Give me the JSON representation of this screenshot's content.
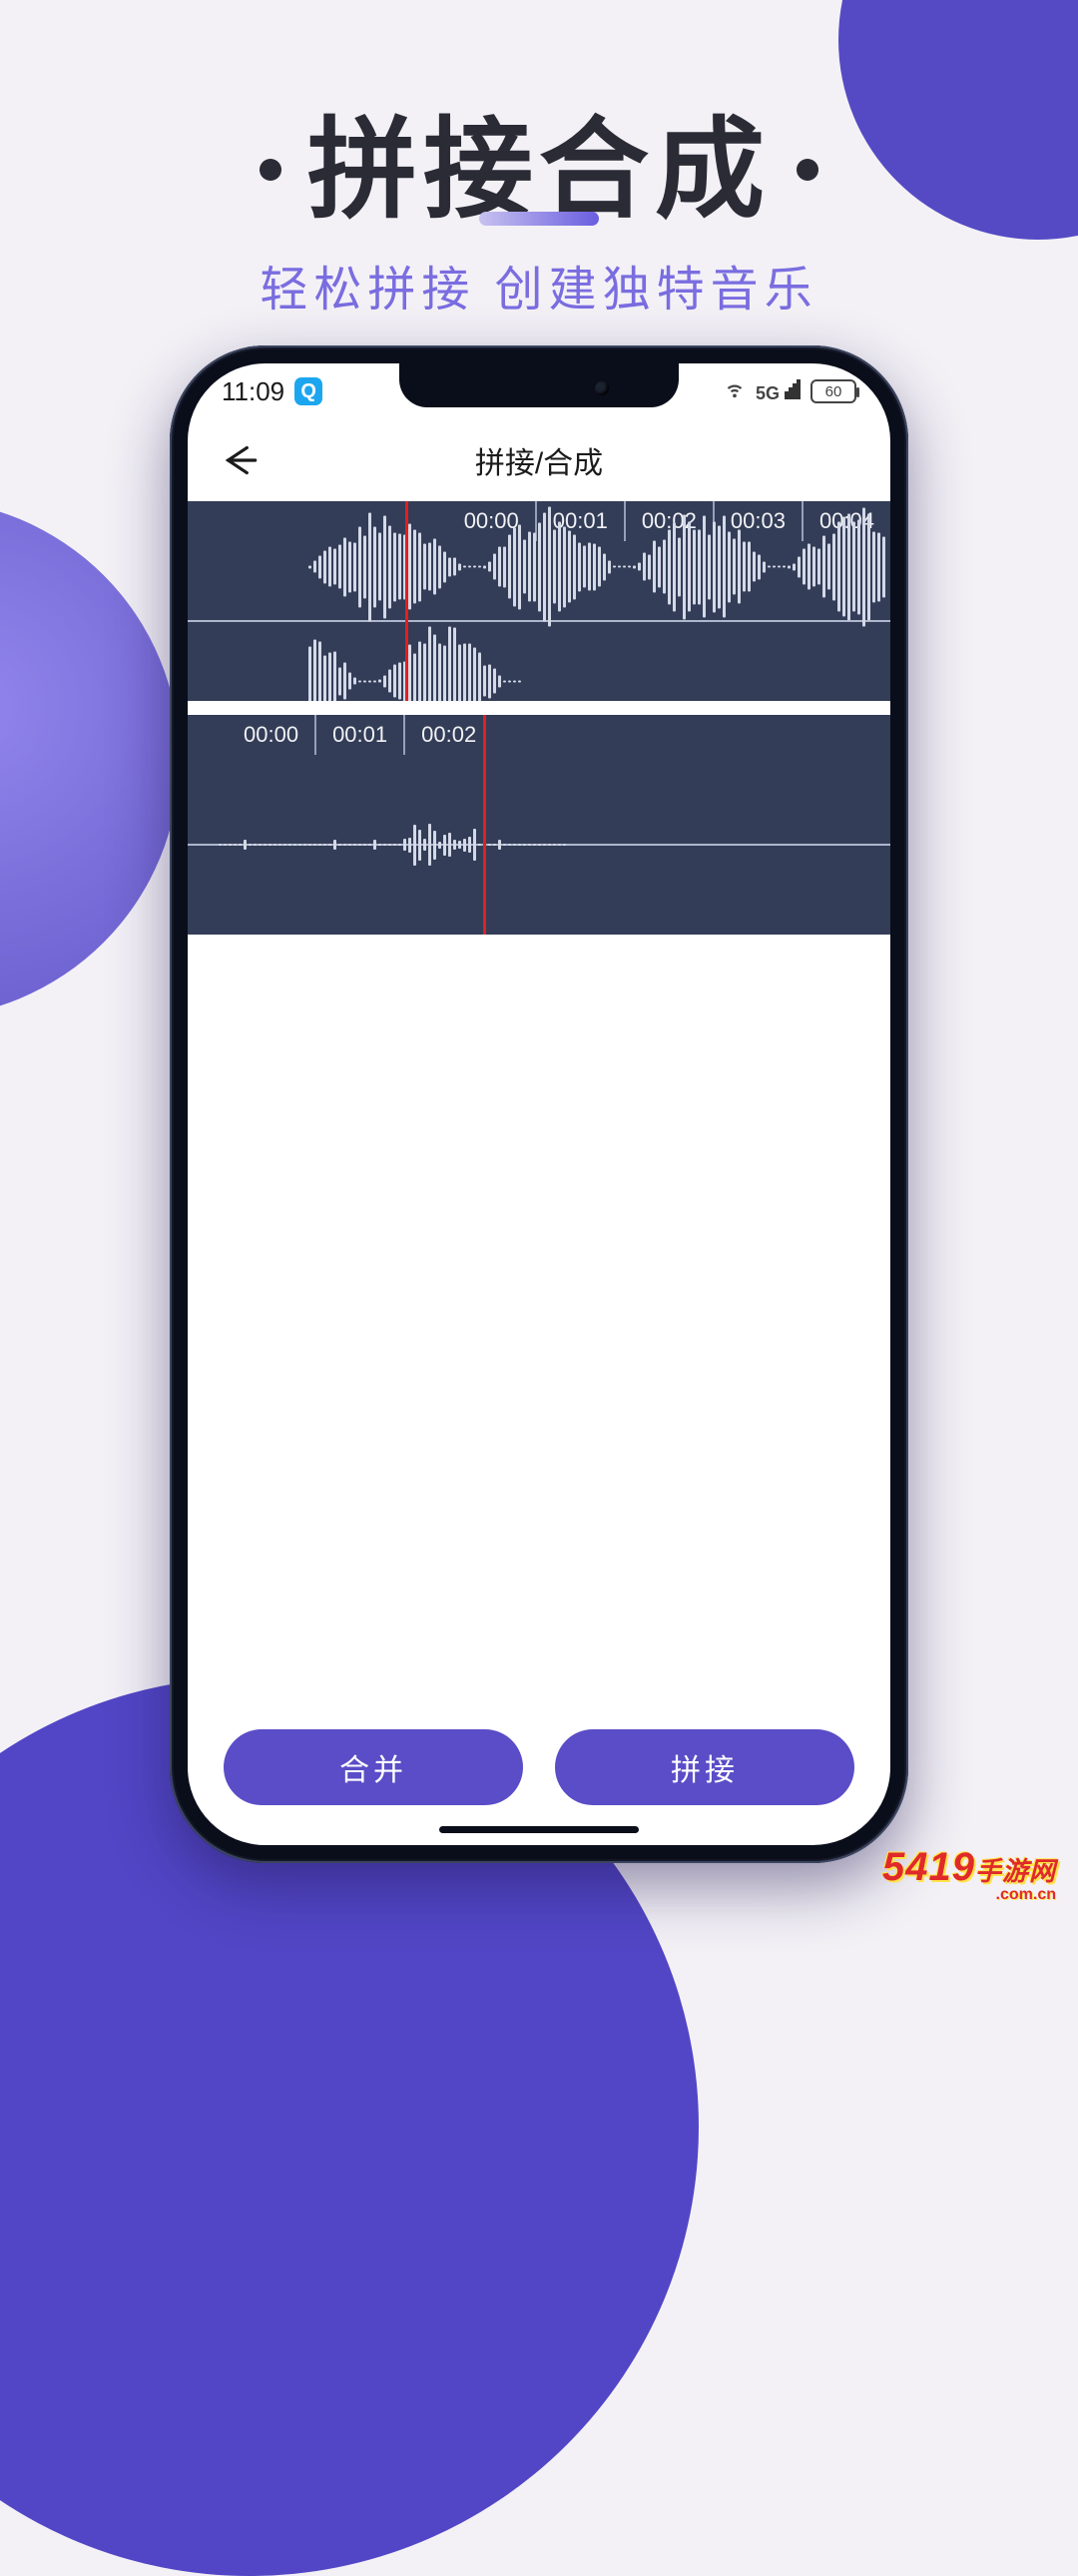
{
  "promo": {
    "title": "拼接合成",
    "subtitle": "轻松拼接 创建独特音乐"
  },
  "status": {
    "time": "11:09",
    "app_badge": "Q",
    "network_label": "5G",
    "battery_text": "60"
  },
  "nav": {
    "title": "拼接/合成"
  },
  "track1": {
    "ticks": [
      "00:00",
      "00:01",
      "00:02",
      "00:03",
      "00:04"
    ],
    "playhead_pct": 31
  },
  "track2": {
    "ticks": [
      "00:00",
      "00:01",
      "00:02"
    ],
    "playhead_pct": 42
  },
  "buttons": {
    "merge": "合并",
    "concat": "拼接"
  },
  "watermark": {
    "brand": "5419",
    "tag": "手游网",
    "domain": ".com.cn"
  }
}
